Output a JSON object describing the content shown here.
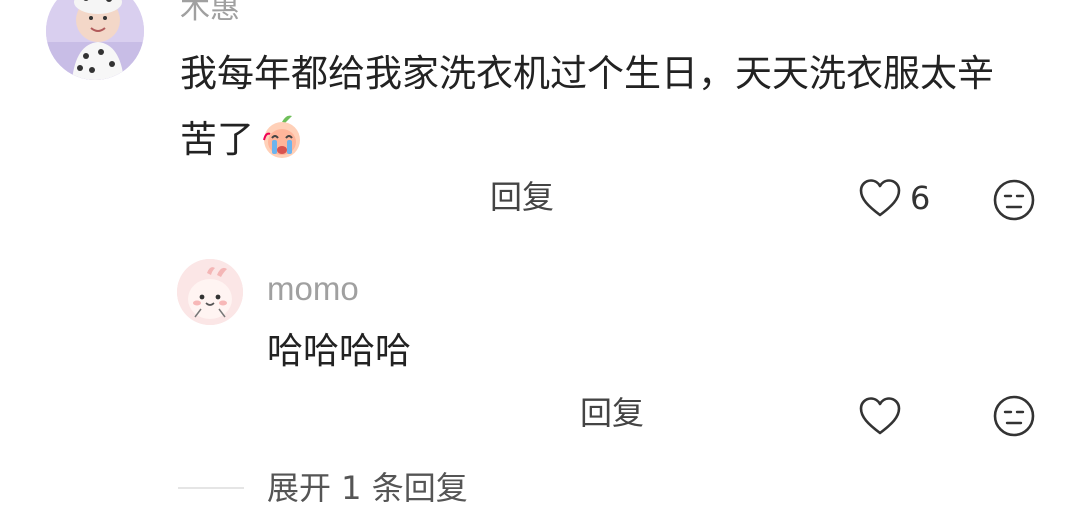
{
  "comment": {
    "username": "木惠",
    "text_line1": "我每年都给我家洗衣机过个生日，天天洗衣服太辛",
    "text_line2": "苦了",
    "emoji": "crying-peach-emoji",
    "reply_label": "回复",
    "like_count": "6"
  },
  "reply": {
    "username": "momo",
    "text": "哈哈哈哈",
    "reply_label": "回复"
  },
  "expand_label": "展开 1 条回复",
  "icons": {
    "like": "heart-outline-icon",
    "dislike": "neutral-face-icon"
  },
  "colors": {
    "username": "#a0a0a0",
    "text": "#222222",
    "icon": "#333333"
  }
}
